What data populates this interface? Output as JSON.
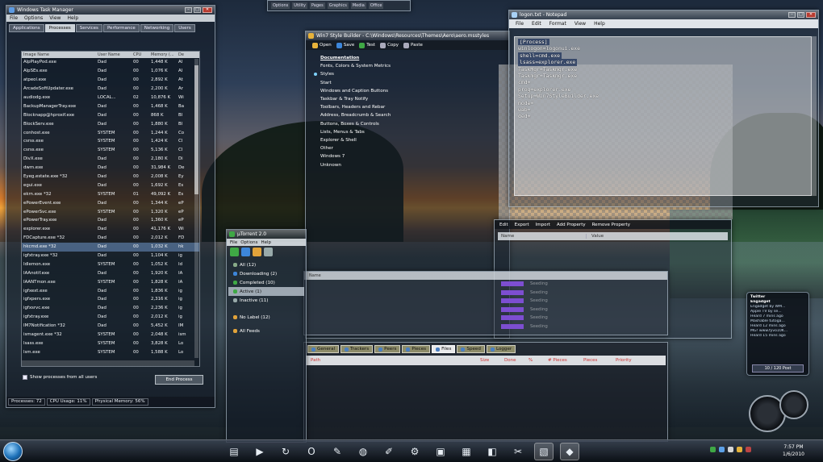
{
  "task_manager": {
    "title": "Windows Task Manager",
    "menu": [
      "File",
      "Options",
      "View",
      "Help"
    ],
    "tabs": [
      "Applications",
      "Processes",
      "Services",
      "Performance",
      "Networking",
      "Users"
    ],
    "active_tab": "Processes",
    "columns": [
      "Image Name",
      "User Name",
      "CPU",
      "Memory (...",
      "De"
    ],
    "processes": [
      {
        "name": "AlpPlayPod.exe",
        "user": "Dad",
        "cpu": "00",
        "mem": "1,448 K",
        "d": "Al"
      },
      {
        "name": "AlpSEs.exe",
        "user": "Dad",
        "cpu": "00",
        "mem": "1,076 K",
        "d": "Al"
      },
      {
        "name": "atpeol.exe",
        "user": "Dad",
        "cpu": "00",
        "mem": "2,892 K",
        "d": "At"
      },
      {
        "name": "ArcadeSoftUpdater.exe",
        "user": "Dad",
        "cpu": "00",
        "mem": "2,200 K",
        "d": "Ar"
      },
      {
        "name": "audiodg.exe",
        "user": "LOCAL...",
        "cpu": "02",
        "mem": "10,876 K",
        "d": "Wi"
      },
      {
        "name": "BackupManagerTray.exe",
        "user": "Dad",
        "cpu": "00",
        "mem": "1,468 K",
        "d": "Ba"
      },
      {
        "name": "Blocknapp@hproxif.exe",
        "user": "Dad",
        "cpu": "00",
        "mem": "868 K",
        "d": "Bl"
      },
      {
        "name": "BlockServ.exe",
        "user": "Dad",
        "cpu": "00",
        "mem": "1,880 K",
        "d": "Bl"
      },
      {
        "name": "conhost.exe",
        "user": "SYSTEM",
        "cpu": "00",
        "mem": "1,244 K",
        "d": "Co"
      },
      {
        "name": "csrss.exe",
        "user": "SYSTEM",
        "cpu": "00",
        "mem": "1,424 K",
        "d": "Cl"
      },
      {
        "name": "csrss.exe",
        "user": "SYSTEM",
        "cpu": "00",
        "mem": "5,136 K",
        "d": "Cl"
      },
      {
        "name": "DivX.exe",
        "user": "Dad",
        "cpu": "00",
        "mem": "2,180 K",
        "d": "Di"
      },
      {
        "name": "dwm.exe",
        "user": "Dad",
        "cpu": "00",
        "mem": "31,984 K",
        "d": "De"
      },
      {
        "name": "Eyeg.estate.exe *32",
        "user": "Dad",
        "cpu": "00",
        "mem": "2,008 K",
        "d": "Ey"
      },
      {
        "name": "egui.exe",
        "user": "Dad",
        "cpu": "00",
        "mem": "1,692 K",
        "d": "Es"
      },
      {
        "name": "ekrn.exe *32",
        "user": "SYSTEM",
        "cpu": "01",
        "mem": "49,092 K",
        "d": "Es"
      },
      {
        "name": "ePowerEvent.exe",
        "user": "Dad",
        "cpu": "00",
        "mem": "1,344 K",
        "d": "eP"
      },
      {
        "name": "ePowerSvc.exe",
        "user": "SYSTEM",
        "cpu": "00",
        "mem": "1,320 K",
        "d": "eP"
      },
      {
        "name": "ePowerTray.exe",
        "user": "Dad",
        "cpu": "00",
        "mem": "1,360 K",
        "d": "eP"
      },
      {
        "name": "explorer.exe",
        "user": "Dad",
        "cpu": "00",
        "mem": "41,176 K",
        "d": "Wi"
      },
      {
        "name": "FDCapture.exe *32",
        "user": "Dad",
        "cpu": "00",
        "mem": "2,012 K",
        "d": "FD"
      },
      {
        "name": "hkcmd.exe *32",
        "user": "Dad",
        "cpu": "00",
        "mem": "1,032 K",
        "d": "hk"
      },
      {
        "name": "igfxtray.exe *32",
        "user": "Dad",
        "cpu": "00",
        "mem": "1,104 K",
        "d": "ig"
      },
      {
        "name": "Idlemon.exe",
        "user": "SYSTEM",
        "cpu": "00",
        "mem": "1,052 K",
        "d": "Id"
      },
      {
        "name": "IAAnotif.exe",
        "user": "Dad",
        "cpu": "00",
        "mem": "1,920 K",
        "d": "IA"
      },
      {
        "name": "IAANTmon.exe",
        "user": "SYSTEM",
        "cpu": "00",
        "mem": "1,828 K",
        "d": "IA"
      },
      {
        "name": "igfxext.exe",
        "user": "Dad",
        "cpu": "00",
        "mem": "1,836 K",
        "d": "ig"
      },
      {
        "name": "igfxpers.exe",
        "user": "Dad",
        "cpu": "00",
        "mem": "2,316 K",
        "d": "ig"
      },
      {
        "name": "igfxsrvc.exe",
        "user": "Dad",
        "cpu": "00",
        "mem": "2,236 K",
        "d": "ig"
      },
      {
        "name": "igfxtray.exe",
        "user": "Dad",
        "cpu": "00",
        "mem": "2,012 K",
        "d": "ig"
      },
      {
        "name": "IM7Notification *32",
        "user": "Dad",
        "cpu": "00",
        "mem": "5,452 K",
        "d": "IM"
      },
      {
        "name": "ismagent.exe *32",
        "user": "SYSTEM",
        "cpu": "00",
        "mem": "2,048 K",
        "d": "ism"
      },
      {
        "name": "lsass.exe",
        "user": "SYSTEM",
        "cpu": "00",
        "mem": "3,828 K",
        "d": "Lo"
      },
      {
        "name": "lsm.exe",
        "user": "SYSTEM",
        "cpu": "00",
        "mem": "1,588 K",
        "d": "Lo"
      }
    ],
    "selected_index": 21,
    "show_all_label": "Show processes from all users",
    "end_process_label": "End Process",
    "status": [
      "Processes: 72",
      "CPU Usage: 11%",
      "Physical Memory: 56%"
    ]
  },
  "top_strip": {
    "items": [
      "Options",
      "Utility",
      "Pages",
      "Graphics",
      "Media",
      "Office"
    ]
  },
  "style_builder": {
    "title": "Win7 Style Builder - C:\\Windows\\Resources\\Themes\\Aero\\aero.msstyles",
    "toolbar": [
      "Open",
      "Save",
      "Test",
      "Copy",
      "Paste"
    ],
    "tree": [
      {
        "label": "Documentation",
        "bold": true
      },
      {
        "label": "Fonts, Colors & System Metrics",
        "bold": false
      },
      {
        "label": "Styles",
        "bold": false,
        "dot": true
      },
      {
        "label": "Start",
        "bold": false
      },
      {
        "label": "Windows and Caption Buttons",
        "bold": false
      },
      {
        "label": "Taskbar & Tray Notify",
        "bold": false
      },
      {
        "label": "Toolbars, Headers and Rebar",
        "bold": false
      },
      {
        "label": "Address, Breadcrumb & Search",
        "bold": false
      },
      {
        "label": "Buttons, Boxes & Controls",
        "bold": false
      },
      {
        "label": "Lists, Menus & Tabs",
        "bold": false
      },
      {
        "label": "Explorer & Shell",
        "bold": false
      },
      {
        "label": "Other",
        "bold": false
      },
      {
        "label": "Windows 7",
        "bold": false
      },
      {
        "label": "Unknown",
        "bold": false
      }
    ]
  },
  "notepad": {
    "title": "logon.txt - Notepad",
    "menu": [
      "File",
      "Edit",
      "Format",
      "View",
      "Help"
    ],
    "lines": [
      "[Process]",
      "winlogon=logonui.exe",
      "shell=cmd.exe",
      "lsass=explorer.exe",
      "TaskMgr=Taskmgr.exe",
      "Taskmgr=Taskmgr.exe",
      "cmd=",
      "prog=explorer.exe",
      "Setup=Win7StyleBuilder.exe",
      "mode=",
      "wab=",
      "ded="
    ],
    "highlight_indexes": [
      0,
      2,
      3
    ]
  },
  "property_panel": {
    "toolbar": [
      "Edit",
      "Export",
      "Import",
      "Add Property",
      "Remove Property"
    ],
    "columns": [
      "Name",
      "Value"
    ]
  },
  "utorrent": {
    "title": "µTorrent 2.0",
    "menu": [
      "File",
      "Options",
      "Help"
    ],
    "categories": [
      {
        "label": "All (12)",
        "selected": false
      },
      {
        "label": "Downloading (2)",
        "selected": false
      },
      {
        "label": "Completed (10)",
        "selected": false
      },
      {
        "label": "Active (1)",
        "selected": true
      },
      {
        "label": "Inactive (11)",
        "selected": false
      },
      {
        "label": "No Label (12)",
        "selected": false
      },
      {
        "label": "All Feeds",
        "selected": false
      }
    ]
  },
  "torrent_list": {
    "header": "Name",
    "rows": [
      "Seeding",
      "Seeding",
      "Seeding",
      "Seeding",
      "Seeding",
      "Seeding"
    ]
  },
  "detail_pane": {
    "tabs": [
      "General",
      "Trackers",
      "Peers",
      "Pieces",
      "Files",
      "Speed",
      "Logger"
    ],
    "active_tab": "Files",
    "columns": [
      "Path",
      "Size",
      "Done",
      "%",
      "# Pieces",
      "Pieces",
      "Priority"
    ]
  },
  "twitter_gadget": {
    "title": "Twitter",
    "tweets": [
      {
        "name": "Engadget",
        "text": "Engadget by WM..."
      },
      {
        "name": "",
        "text": "Apple TV by se..."
      },
      {
        "name": "",
        "text": "Heard 7 mins ago"
      },
      {
        "name": "",
        "text": "Mashable tutoga..."
      },
      {
        "name": "",
        "text": "Heard 12 mins ago"
      },
      {
        "name": "",
        "text": "MG! www.fyvo10K..."
      },
      {
        "name": "",
        "text": "Heard 15 mins ago"
      }
    ],
    "footer": "10 / 120 Post"
  },
  "taskbar": {
    "tasks": [
      "folder",
      "play",
      "refresh",
      "opera",
      "pen",
      "ball",
      "note",
      "gear",
      "media",
      "clapper",
      "video",
      "tools",
      "taskmgr",
      "style"
    ],
    "active_tasks": [
      12,
      13
    ],
    "clock_time": "7:57 PM",
    "clock_date": "1/6/2010"
  },
  "colors": {
    "accent": "#7d4ed1",
    "selection": "#6e96c8",
    "close": "#b73a2f"
  }
}
